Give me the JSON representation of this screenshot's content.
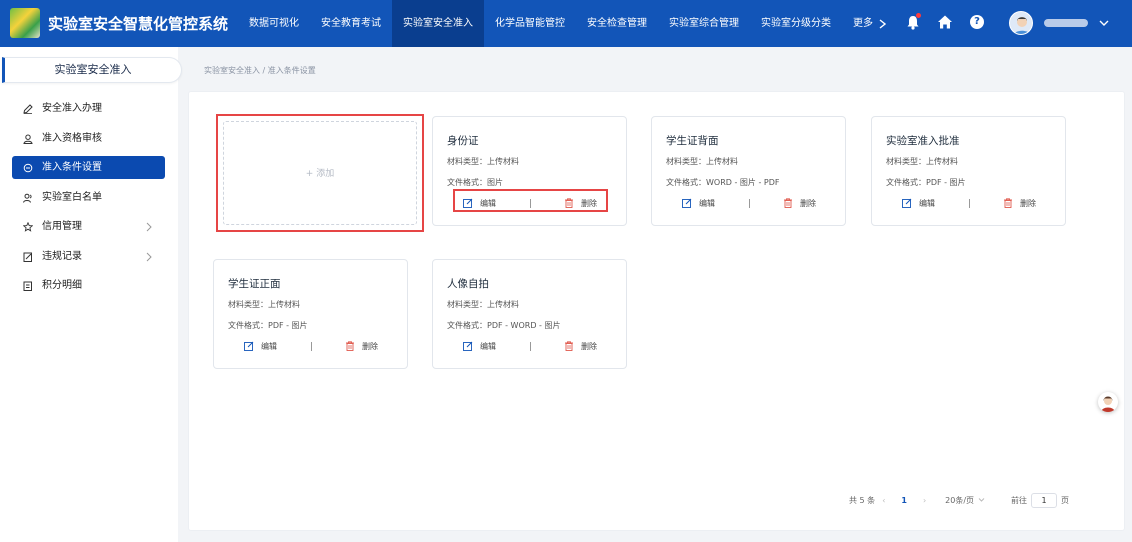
{
  "app": {
    "title": "实验室安全智慧化管控系统"
  },
  "nav": {
    "items": [
      "数据可视化",
      "安全教育考试",
      "实验室安全准入",
      "化学品智能管控",
      "安全检查管理",
      "实验室综合管理",
      "实验室分级分类"
    ],
    "active_index": 2,
    "more_label": "更多"
  },
  "header_icons": {
    "notification": "bell-icon",
    "home": "home-icon",
    "help": "help-icon",
    "help_glyph": "?",
    "user_menu": "chevron-down-icon"
  },
  "colors": {
    "primary": "#1255b8",
    "active_nav": "#0a3e8f",
    "sidebar_active": "#0b4ab0",
    "highlight": "#e64545",
    "delete_icon": "#e05a4e"
  },
  "sidebar": {
    "header": "实验室安全准入",
    "items": [
      {
        "label": "安全准入办理",
        "icon": "edit-icon",
        "has_arrow": false
      },
      {
        "label": "准入资格审核",
        "icon": "user-icon",
        "has_arrow": false
      },
      {
        "label": "准入条件设置",
        "icon": "settings-icon",
        "has_arrow": false,
        "active": true
      },
      {
        "label": "实验室白名单",
        "icon": "users-icon",
        "has_arrow": false
      },
      {
        "label": "信用管理",
        "icon": "star-icon",
        "has_arrow": true
      },
      {
        "label": "违规记录",
        "icon": "record-icon",
        "has_arrow": true
      },
      {
        "label": "积分明细",
        "icon": "points-icon",
        "has_arrow": false
      }
    ]
  },
  "breadcrumb": {
    "text": "实验室安全准入  /  准入条件设置"
  },
  "add_card": {
    "label": "+  添加"
  },
  "cards": [
    {
      "title": "身份证",
      "material": "材料类型：上传材料",
      "format": "文件格式：图片"
    },
    {
      "title": "学生证背面",
      "material": "材料类型：上传材料",
      "format": "文件格式：WORD - 图片 - PDF"
    },
    {
      "title": "实验室准入批准",
      "material": "材料类型：上传材料",
      "format": "文件格式：PDF - 图片"
    },
    {
      "title": "学生证正面",
      "material": "材料类型：上传材料",
      "format": "文件格式：PDF - 图片"
    },
    {
      "title": "人像自拍",
      "material": "材料类型：上传材料",
      "format": "文件格式：PDF - WORD - 图片"
    }
  ],
  "card_actions": {
    "edit": "编辑",
    "delete": "删除"
  },
  "pagination": {
    "total": "共 5 条",
    "current_page": "1",
    "page_size": "20条/页",
    "goto_label": "前往",
    "goto_value": "1",
    "page_unit": "页"
  }
}
